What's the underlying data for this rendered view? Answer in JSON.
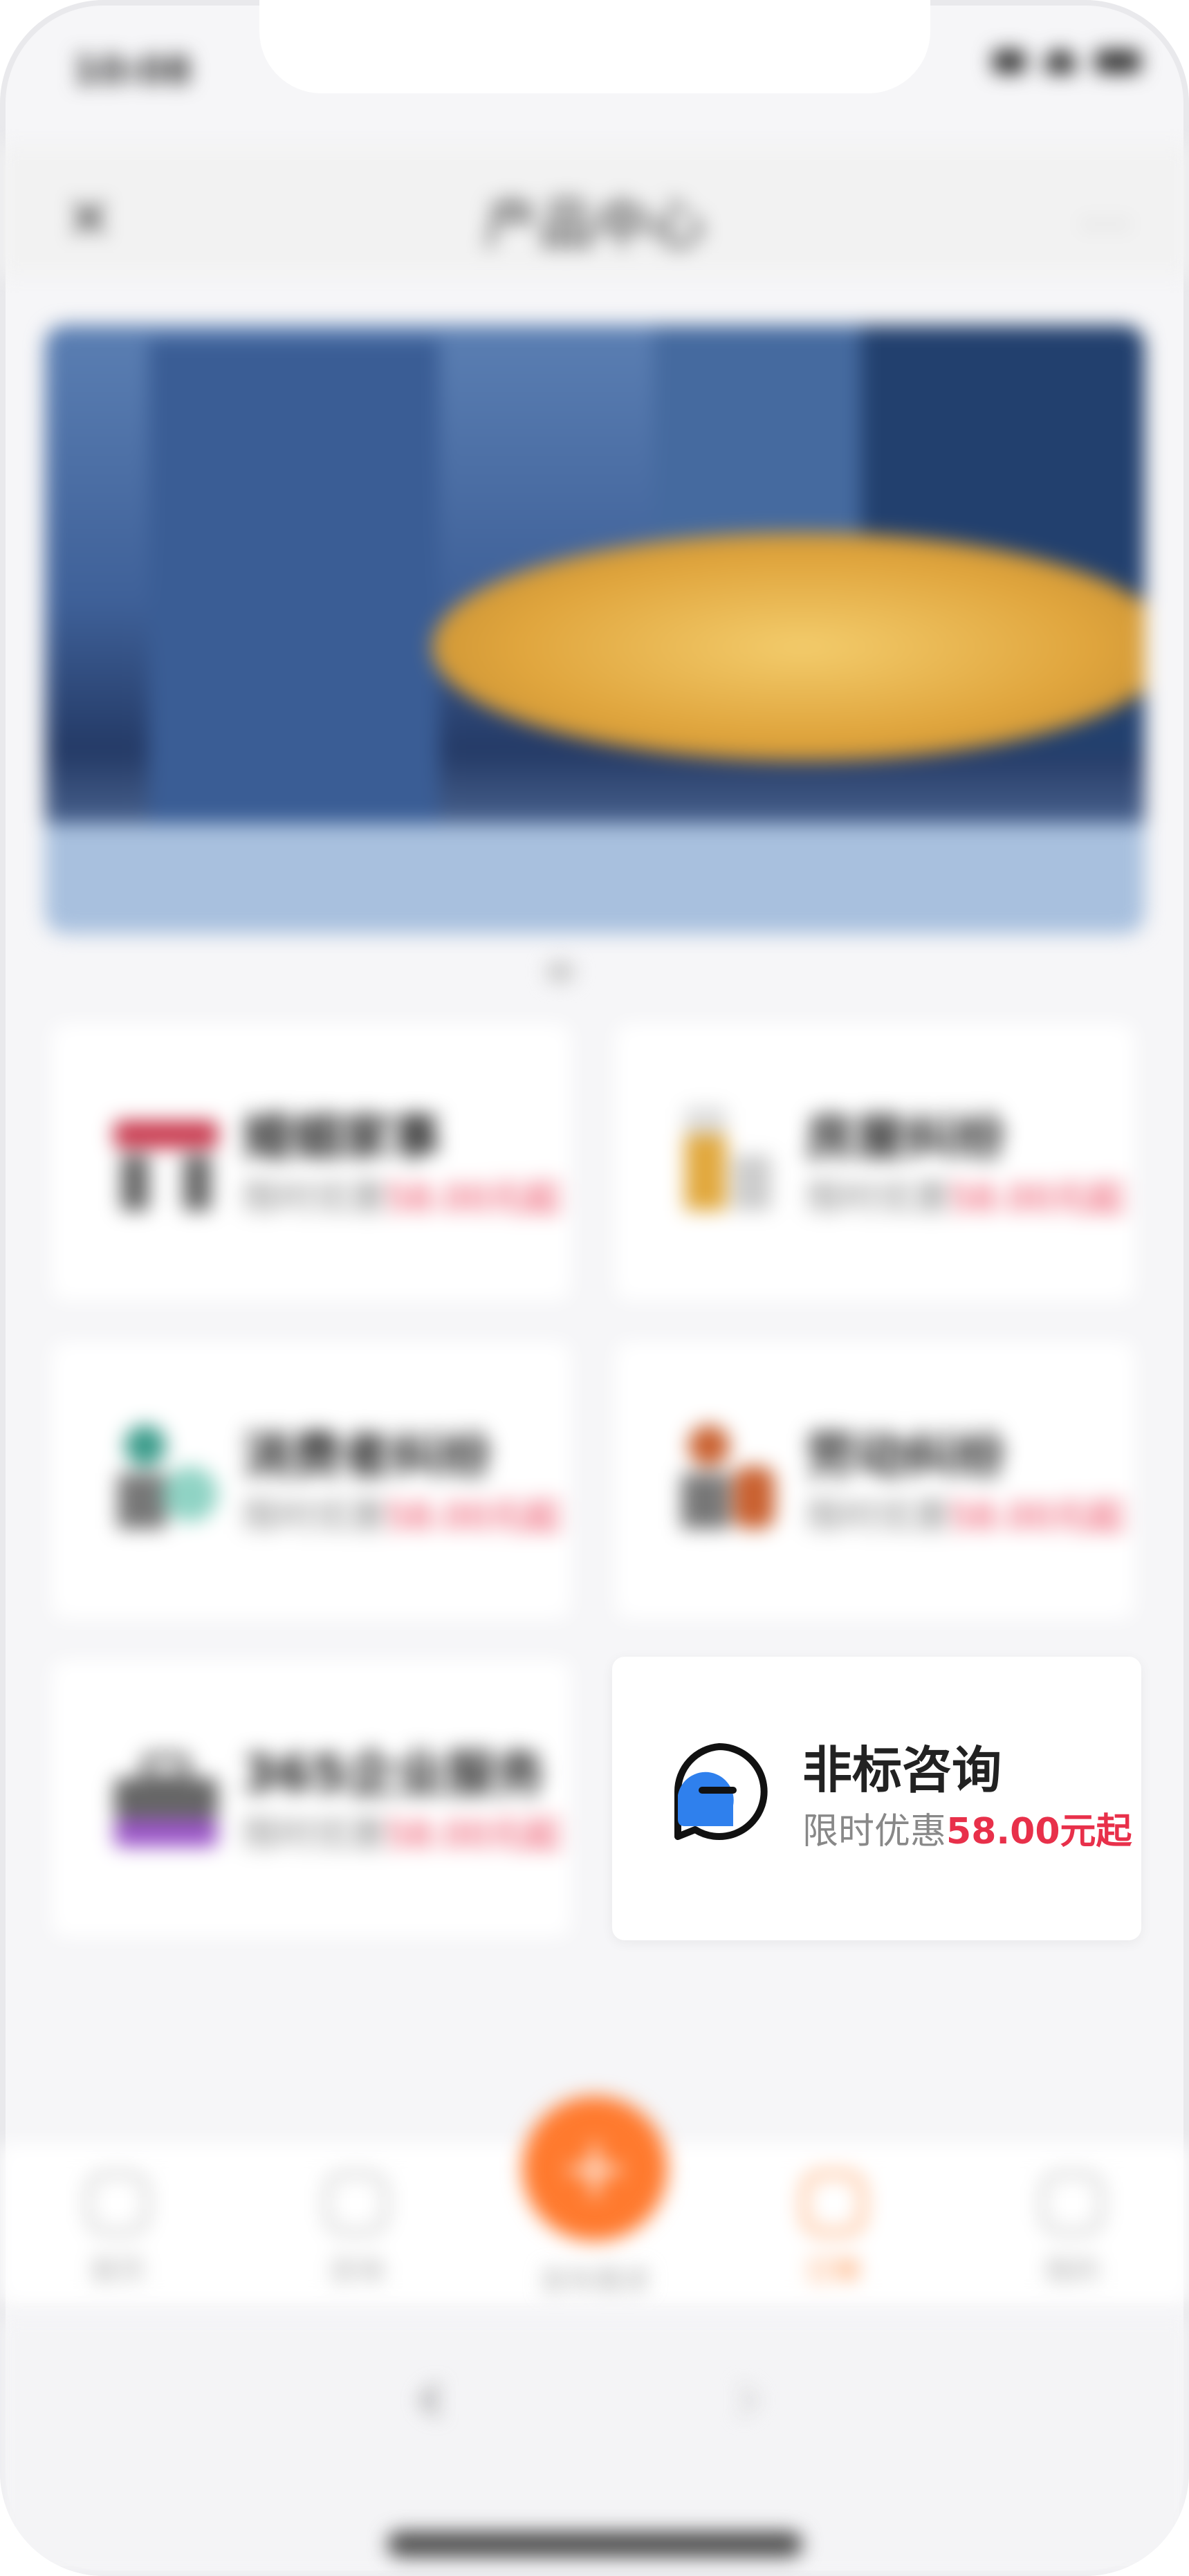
{
  "status_bar": {
    "time": "10:08"
  },
  "navbar": {
    "close": "✕",
    "title": "产品中心",
    "more": "···"
  },
  "products": [
    {
      "title": "婚姻家事",
      "sub_prefix": "限时优惠",
      "price": "58.00元起",
      "icon": "family-icon",
      "accent": "#c8384d"
    },
    {
      "title": "房屋纠纷",
      "sub_prefix": "限时优惠",
      "price": "58.00元起",
      "icon": "house-icon",
      "accent": "#e1a83d"
    },
    {
      "title": "消费者纠纷",
      "sub_prefix": "限时优惠",
      "price": "58.00元起",
      "icon": "consumer-icon",
      "accent": "#3a9b8a"
    },
    {
      "title": "劳动纠纷",
      "sub_prefix": "限时优惠",
      "price": "58.00元起",
      "icon": "labor-icon",
      "accent": "#c9602f"
    },
    {
      "title": "365企业服务",
      "sub_prefix": "限时优惠",
      "price": "58.00元起",
      "icon": "briefcase-icon",
      "accent": "#9b55c8"
    },
    {
      "title": "非标咨询",
      "sub_prefix": "限时优惠",
      "price": "58.00元起",
      "icon": "chat-icon",
      "accent": "#2f80ed"
    }
  ],
  "tabbar": {
    "tabs": [
      "首页",
      "咨询",
      "订单",
      "我的"
    ],
    "fab_label": "发布需求",
    "active": "订单"
  },
  "colors": {
    "accent": "#ff7a2e",
    "price": "#e8304a"
  }
}
